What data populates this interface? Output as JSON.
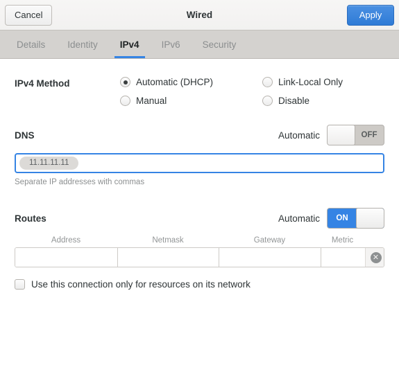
{
  "window": {
    "title": "Wired",
    "cancel_label": "Cancel",
    "apply_label": "Apply",
    "accent_color": "#3584e4"
  },
  "tabs": [
    {
      "label": "Details",
      "active": false
    },
    {
      "label": "Identity",
      "active": false
    },
    {
      "label": "IPv4",
      "active": true
    },
    {
      "label": "IPv6",
      "active": false
    },
    {
      "label": "Security",
      "active": false
    }
  ],
  "ipv4_method": {
    "label": "IPv4 Method",
    "options": [
      {
        "label": "Automatic (DHCP)",
        "selected": true
      },
      {
        "label": "Link-Local Only",
        "selected": false
      },
      {
        "label": "Manual",
        "selected": false
      },
      {
        "label": "Disable",
        "selected": false
      }
    ]
  },
  "dns": {
    "label": "DNS",
    "automatic_label": "Automatic",
    "toggle_state": "OFF",
    "entries": [
      "11.11.11.11"
    ],
    "hint": "Separate IP addresses with commas"
  },
  "routes": {
    "label": "Routes",
    "automatic_label": "Automatic",
    "toggle_state": "ON",
    "columns": [
      "Address",
      "Netmask",
      "Gateway",
      "Metric"
    ],
    "rows": [
      {
        "address": "",
        "netmask": "",
        "gateway": "",
        "metric": ""
      }
    ],
    "delete_icon": "close-circle-icon"
  },
  "restrict_checkbox": {
    "label": "Use this connection only for resources on its network",
    "checked": false
  }
}
